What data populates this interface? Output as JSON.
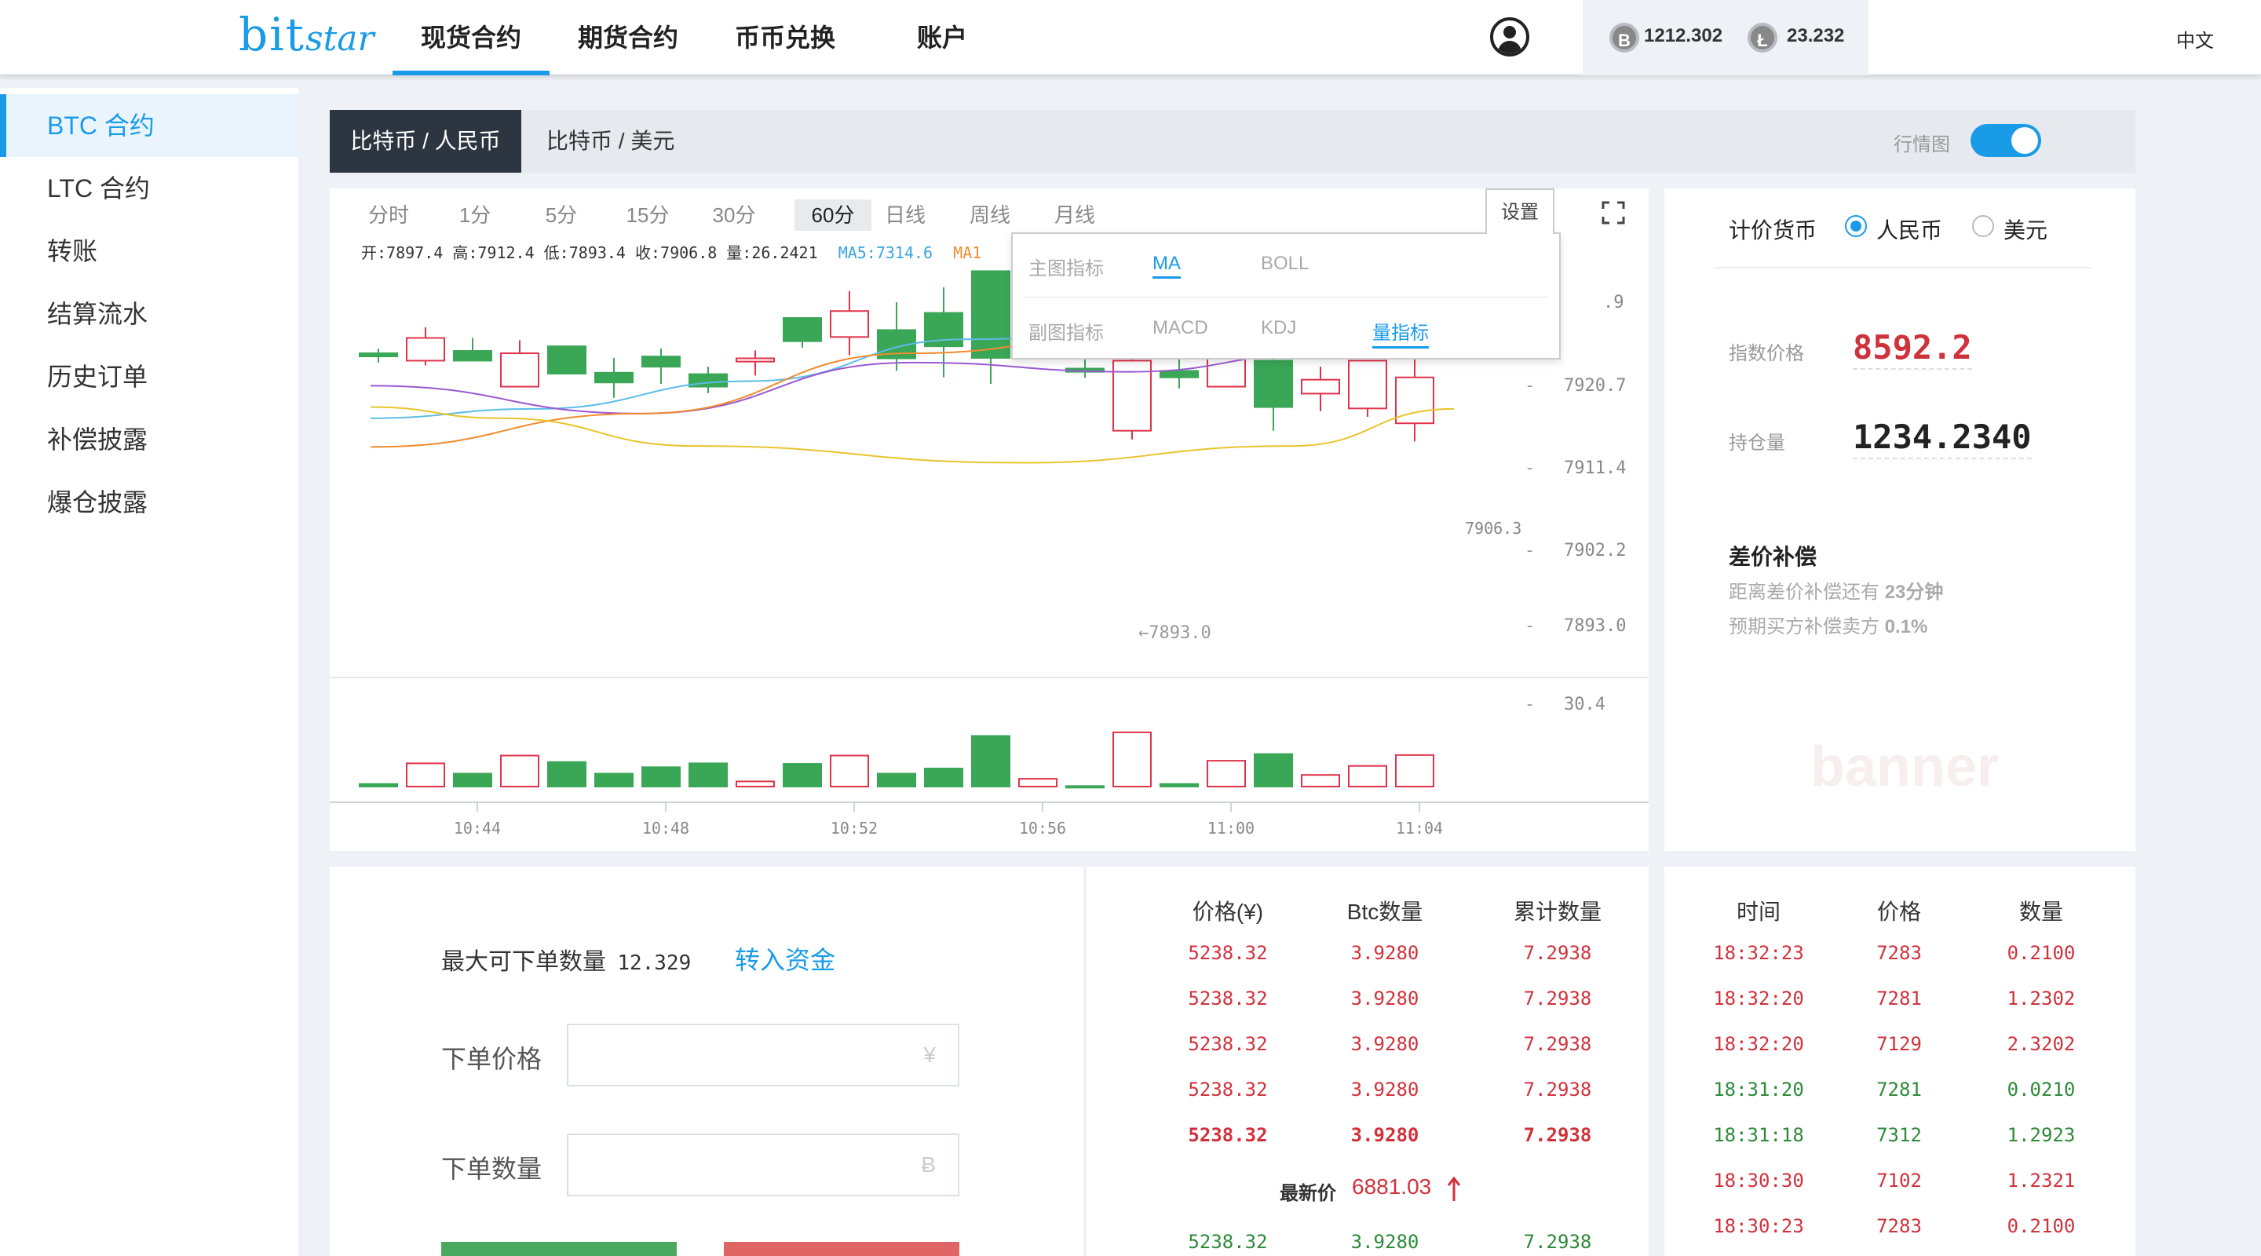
{
  "logo": {
    "part1": "bit",
    "part2": "star"
  },
  "nav": {
    "tabs": [
      "现货合约",
      "期货合约",
      "币币兑换",
      "账户"
    ],
    "active_index": 0,
    "balances": [
      {
        "icon": "bitcoin-icon",
        "symbol": "B",
        "value": "1212.302"
      },
      {
        "icon": "litecoin-icon",
        "symbol": "Ł",
        "value": "23.232"
      }
    ],
    "language": "中文"
  },
  "sidebar": {
    "items": [
      "BTC 合约",
      "LTC 合约",
      "转账",
      "结算流水",
      "历史订单",
      "补偿披露",
      "爆仓披露"
    ],
    "active_index": 0
  },
  "pairs": {
    "active": "比特币 / 人民币",
    "other": "比特币 / 美元",
    "market_toggle_label": "行情图",
    "market_toggle_on": true
  },
  "chart": {
    "timeframes": [
      "分时",
      "1分",
      "5分",
      "15分",
      "30分",
      "60分",
      "日线",
      "周线",
      "月线"
    ],
    "active_timeframe": "60分",
    "ohlc_text": "开:7897.4  高:7912.4  低:7893.4  收:7906.8  量:26.2421",
    "ma5_text": "MA5:7314.6",
    "ma10_text": "MA1",
    "settings_label": "设置",
    "settings_popup": {
      "main_label": "主图指标",
      "main_options": [
        "MA",
        "BOLL"
      ],
      "main_selected": "MA",
      "sub_label": "副图指标",
      "sub_options": [
        "MACD",
        "KDJ",
        "量指标"
      ],
      "sub_selected": "量指标"
    },
    "price_labels": [
      "7929.9",
      "7920.7",
      "7911.4",
      "7902.2",
      "7893.0"
    ],
    "price_label_top_visible": ".9",
    "last_price_label": "7906.3",
    "low_annotation": "←7893.0",
    "volume_label": "30.4",
    "time_labels": [
      "10:44",
      "10:48",
      "10:52",
      "10:56",
      "11:00",
      "11:04"
    ],
    "colors": {
      "up": "#3aa757",
      "down": "#e0334a",
      "ma5": "#5bbde6",
      "ma10": "#9b59d0",
      "ma20": "#f08c2e",
      "ma30": "#e8c42c"
    }
  },
  "chart_data": {
    "type": "candlestick",
    "ylim": [
      7890,
      7934
    ],
    "volume_max": 30.4,
    "candles": [
      {
        "o": 7912.0,
        "c": 7911.4,
        "h": 7913.0,
        "l": 7910.0,
        "v": 1,
        "up": true
      },
      {
        "o": 7910.4,
        "c": 7915.3,
        "h": 7917.6,
        "l": 7909.4,
        "v": 9,
        "up": false
      },
      {
        "o": 7912.5,
        "c": 7910.4,
        "h": 7915.3,
        "l": 7910.4,
        "v": 5,
        "up": true
      },
      {
        "o": 7904.8,
        "c": 7912.0,
        "h": 7914.8,
        "l": 7904.8,
        "v": 12,
        "up": false
      },
      {
        "o": 7913.5,
        "c": 7907.6,
        "h": 7913.5,
        "l": 7907.6,
        "v": 9.5,
        "up": true
      },
      {
        "o": 7907.8,
        "c": 7905.7,
        "h": 7911.0,
        "l": 7902.4,
        "v": 5,
        "up": true
      },
      {
        "o": 7911.3,
        "c": 7909.1,
        "h": 7913.0,
        "l": 7905.4,
        "v": 7.5,
        "up": true
      },
      {
        "o": 7907.5,
        "c": 7904.8,
        "h": 7909.1,
        "l": 7903.4,
        "v": 9,
        "up": true
      },
      {
        "o": 7910.2,
        "c": 7910.9,
        "h": 7912.6,
        "l": 7907.2,
        "v": 2,
        "up": false
      },
      {
        "o": 7914.6,
        "c": 7919.6,
        "h": 7919.6,
        "l": 7913.2,
        "v": 8.8,
        "up": true
      },
      {
        "o": 7915.5,
        "c": 7921.1,
        "h": 7925.4,
        "l": 7911.6,
        "v": 12,
        "up": false
      },
      {
        "o": 7917.0,
        "c": 7910.9,
        "h": 7923.0,
        "l": 7908.2,
        "v": 5,
        "up": true
      },
      {
        "o": 7920.7,
        "c": 7913.5,
        "h": 7926.2,
        "l": 7906.8,
        "v": 7,
        "up": true
      },
      {
        "o": 7929.7,
        "c": 7911.0,
        "h": 7929.7,
        "l": 7905.4,
        "v": 19.6,
        "up": true
      },
      {
        "o": 7915.2,
        "c": 7915.9,
        "h": 7921.9,
        "l": 7914.2,
        "v": 3,
        "up": false
      },
      {
        "o": 7908.7,
        "c": 7908.0,
        "h": 7910.9,
        "l": 7906.7,
        "v": 0.2,
        "up": true
      },
      {
        "o": 7895.3,
        "c": 7910.4,
        "h": 7914.2,
        "l": 7893.4,
        "v": 21,
        "up": false
      },
      {
        "o": 7908.2,
        "c": 7906.8,
        "h": 7911.3,
        "l": 7904.4,
        "v": 1,
        "up": true
      },
      {
        "o": 7904.8,
        "c": 7914.2,
        "h": 7916.8,
        "l": 7904.8,
        "v": 10,
        "up": false
      },
      {
        "o": 7910.4,
        "c": 7900.4,
        "h": 7914.0,
        "l": 7895.3,
        "v": 12.6,
        "up": true
      },
      {
        "o": 7903.3,
        "c": 7906.3,
        "h": 7909.1,
        "l": 7899.5,
        "v": 4.5,
        "up": false
      },
      {
        "o": 7900.1,
        "c": 7910.4,
        "h": 7910.4,
        "l": 7898.3,
        "v": 8,
        "up": false
      },
      {
        "o": 7896.9,
        "c": 7906.8,
        "h": 7912.0,
        "l": 7893.0,
        "v": 12.2,
        "up": false
      }
    ],
    "ma5": [
      [
        7898.0,
        0
      ],
      [
        7900,
        0.15
      ],
      [
        7906,
        0.35
      ],
      [
        7915,
        0.55
      ],
      [
        7915.5,
        0.65
      ],
      [
        7912,
        0.9
      ],
      [
        7911,
        1.0
      ]
    ],
    "ma10": [
      [
        7905.0,
        0
      ],
      [
        7899,
        0.25
      ],
      [
        7910,
        0.5
      ],
      [
        7908,
        0.7
      ],
      [
        7912,
        0.88
      ],
      [
        7917,
        1.0
      ]
    ],
    "ma20": [
      [
        7891.8,
        0
      ],
      [
        7899,
        0.25
      ],
      [
        7912,
        0.5
      ],
      [
        7918,
        0.75
      ],
      [
        7921,
        1.0
      ]
    ],
    "ma30": [
      [
        7900.4,
        0
      ],
      [
        7898,
        0.12
      ],
      [
        7892,
        0.3
      ],
      [
        7888.4,
        0.6
      ],
      [
        7892,
        0.85
      ],
      [
        7900,
        1.0
      ]
    ]
  },
  "info": {
    "currency_label": "计价货币",
    "currency_options": [
      "人民币",
      "美元"
    ],
    "currency_selected": "人民币",
    "index_price_label": "指数价格",
    "index_price": "8592.2",
    "position_label": "持仓量",
    "position": "1234.2340",
    "comp_title": "差价补偿",
    "comp_line1_prefix": "距离差价补偿还有",
    "comp_line1_value": "23分钟",
    "comp_line2_prefix": "预期买方补偿卖方",
    "comp_line2_value": "0.1%",
    "banner": "banner"
  },
  "order": {
    "max_label": "最大可下单数量",
    "max_value": "12.329",
    "transfer_link": "转入资金",
    "price_label": "下单价格",
    "price_unit": "¥",
    "qty_label": "下单数量",
    "qty_unit": "Ƀ"
  },
  "book": {
    "headers": [
      "价格(¥)",
      "Btc数量",
      "累计数量"
    ],
    "asks": [
      [
        "5238.32",
        "3.9280",
        "7.2938"
      ],
      [
        "5238.32",
        "3.9280",
        "7.2938"
      ],
      [
        "5238.32",
        "3.9280",
        "7.2938"
      ],
      [
        "5238.32",
        "3.9280",
        "7.2938"
      ],
      [
        "5238.32",
        "3.9280",
        "7.2938"
      ]
    ],
    "latest_label": "最新价",
    "latest_value": "6881.03",
    "bids": [
      [
        "5238.32",
        "3.9280",
        "7.2938"
      ]
    ]
  },
  "trades": {
    "headers": [
      "时间",
      "价格",
      "数量"
    ],
    "rows": [
      {
        "time": "18:32:23",
        "price": "7283",
        "qty": "0.2100",
        "side": "red"
      },
      {
        "time": "18:32:20",
        "price": "7281",
        "qty": "1.2302",
        "side": "red"
      },
      {
        "time": "18:32:20",
        "price": "7129",
        "qty": "2.3202",
        "side": "red"
      },
      {
        "time": "18:31:20",
        "price": "7281",
        "qty": "0.0210",
        "side": "green"
      },
      {
        "time": "18:31:18",
        "price": "7312",
        "qty": "1.2923",
        "side": "green"
      },
      {
        "time": "18:30:30",
        "price": "7102",
        "qty": "1.2321",
        "side": "red"
      },
      {
        "time": "18:30:23",
        "price": "7283",
        "qty": "0.2100",
        "side": "red"
      }
    ]
  }
}
